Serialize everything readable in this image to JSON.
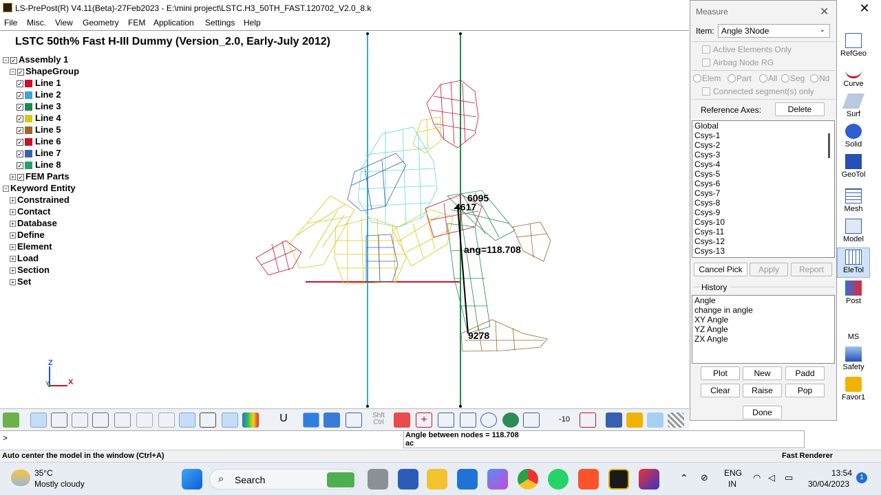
{
  "window": {
    "title": "LS-PrePost(R) V4.11(Beta)-27Feb2023 - E:\\mini project\\LSTC.H3_50TH_FAST.120702_V2.0_8.k",
    "close_glyph": "✕"
  },
  "menu": [
    "File",
    "Misc.",
    "View",
    "Geometry",
    "FEM",
    "Application",
    "Settings",
    "Help"
  ],
  "viewport": {
    "model_title": "LSTC 50th% Fast H-III Dummy (Version_2.0, Early-July 2012)",
    "node_labels": [
      "6095",
      "4617",
      "9278"
    ],
    "angle_label": "ang=118.708",
    "axis_labels": [
      "Z",
      "Y",
      "X"
    ]
  },
  "tree": {
    "assembly": "Assembly 1",
    "shape_group": "ShapeGroup",
    "lines": [
      {
        "label": "Line 1",
        "color": "#c8102e"
      },
      {
        "label": "Line 2",
        "color": "#3aa6dd"
      },
      {
        "label": "Line 3",
        "color": "#1e8a4c"
      },
      {
        "label": "Line 4",
        "color": "#d8c81a"
      },
      {
        "label": "Line 5",
        "color": "#a0642a"
      },
      {
        "label": "Line 6",
        "color": "#c8102e"
      },
      {
        "label": "Line 7",
        "color": "#3a5fb0"
      },
      {
        "label": "Line 8",
        "color": "#23a36b"
      }
    ],
    "fem_parts": "FEM Parts",
    "keyword_entity": "Keyword Entity",
    "keywords": [
      "Constrained",
      "Contact",
      "Database",
      "Define",
      "Element",
      "Load",
      "Section",
      "Set"
    ]
  },
  "bottom_toolbar": {
    "shift_ctrl": [
      "Shft",
      "Ctrl"
    ],
    "zoom_value": "-10"
  },
  "command": {
    "prompt": ">",
    "messages": [
      "Angle between nodes = 118.708",
      "ac"
    ]
  },
  "status": {
    "left": "Auto center the model in the window (Ctrl+A)",
    "right": "Fast Renderer"
  },
  "measure": {
    "header": "Measure",
    "item_label": "Item:",
    "item_value": "Angle 3Node",
    "active_elements_only": "Active Elements Only",
    "airbag_node_rg": "Airbag Node RG",
    "radios": [
      "Elem",
      "Part",
      "All",
      "Seg",
      "Nd"
    ],
    "connected_only": "Connected segment(s) only",
    "reference_axes_label": "Reference Axes:",
    "delete_button": "Delete",
    "axes": [
      "Global",
      "Csys-1",
      "Csys-2",
      "Csys-3",
      "Csys-4",
      "Csys-5",
      "Csys-6",
      "Csys-7",
      "Csys-8",
      "Csys-9",
      "Csys-10",
      "Csys-11",
      "Csys-12",
      "Csys-13"
    ],
    "cancel_pick": "Cancel Pick",
    "apply": "Apply",
    "report": "Report",
    "history_label": "History",
    "history": [
      "Angle",
      "change in angle",
      "XY Angle",
      "YZ Angle",
      "ZX Angle"
    ],
    "buttons": {
      "plot": "Plot",
      "new": "New",
      "padd": "Padd",
      "clear": "Clear",
      "raise": "Raise",
      "pop": "Pop",
      "done": "Done"
    }
  },
  "right_tools": [
    "RefGeo",
    "Curve",
    "Surf",
    "Solid",
    "GeoTol",
    "Mesh",
    "Model",
    "EleTol",
    "Post",
    "MS",
    "Safety",
    "Favor1"
  ],
  "taskbar": {
    "weather_temp": "35°C",
    "weather_cond": "Mostly cloudy",
    "search_placeholder": "Search",
    "lang_line1": "ENG",
    "lang_line2": "IN",
    "time": "13:54",
    "date": "30/04/2023",
    "notification_count": "1"
  }
}
